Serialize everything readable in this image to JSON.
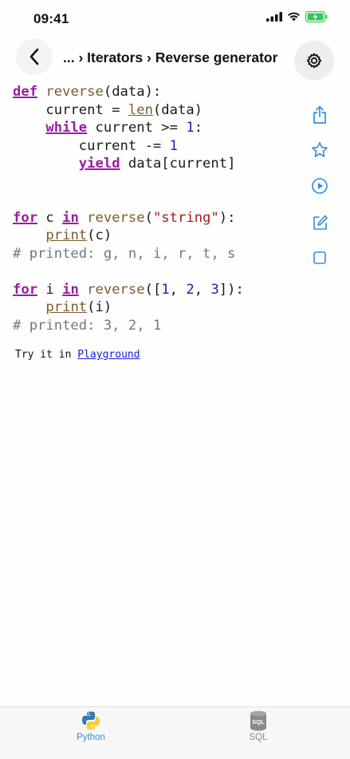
{
  "status": {
    "time": "09:41"
  },
  "header": {
    "breadcrumb": "... › Iterators › Reverse generator"
  },
  "code_lines": {
    "l1_kw": "def",
    "l1_fn": "reverse",
    "l1_rest": "(data):",
    "l2_a": "    current = ",
    "l2_fn": "len",
    "l2_b": "(data)",
    "l3_kw": "while",
    "l3_a": " current >= ",
    "l3_num": "1",
    "l3_b": ":",
    "l4_a": "        current -= ",
    "l4_num": "1",
    "l5_kw": "yield",
    "l5_a": " data[current]",
    "l6_kw1": "for",
    "l6_a": " c ",
    "l6_kw2": "in",
    "l6_fn": " reverse",
    "l6_b": "(",
    "l6_str": "\"string\"",
    "l6_c": "):",
    "l7_fn": "print",
    "l7_a": "(c)",
    "l8_cmt": "# printed: g, n, i, r, t, s",
    "l9_kw1": "for",
    "l9_a": " i ",
    "l9_kw2": "in",
    "l9_fn": " reverse",
    "l9_b": "([",
    "l9_n1": "1",
    "l9_c": ", ",
    "l9_n2": "2",
    "l9_d": ", ",
    "l9_n3": "3",
    "l9_e": "]):",
    "l10_fn": "print",
    "l10_a": "(i)",
    "l11_cmt": "# printed: 3, 2, 1"
  },
  "try_it": {
    "prefix": "Try it in ",
    "link": "Playground"
  },
  "side_toolbar": [
    "share-icon",
    "star-icon",
    "play-icon",
    "edit-icon",
    "square-icon"
  ],
  "tabs": [
    {
      "label": "Python",
      "icon": "python-icon",
      "active": true
    },
    {
      "label": "SQL",
      "icon": "sql-database-icon",
      "active": false
    }
  ],
  "colors": {
    "accent": "#2f8de4",
    "keyword": "#9a1ea0",
    "string": "#a41a1a",
    "number": "#1f1fae",
    "comment": "#6c7a84"
  }
}
